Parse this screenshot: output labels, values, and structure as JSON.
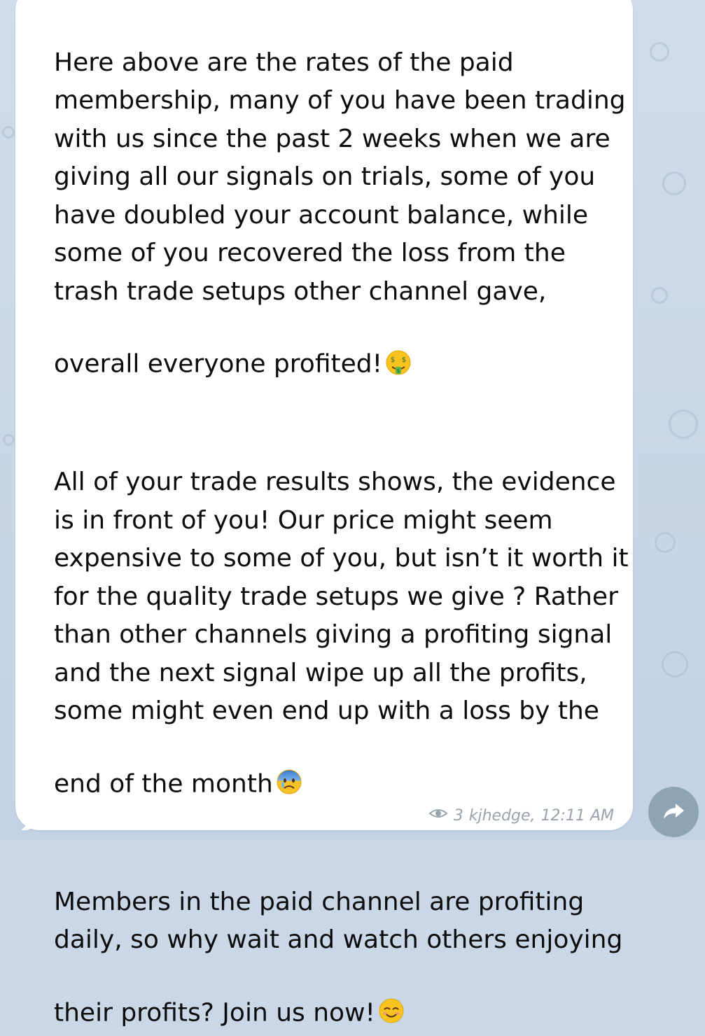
{
  "message": {
    "paragraphs": [
      "Here above are the rates of the paid membership, many of you have been trading with us since the past 2 weeks when we are giving all our signals on trials, some of you have doubled your account balance, while some of you recovered the loss from the trash trade setups other channel gave, overall everyone profited!",
      "All of your trade results shows, the evidence is in front of you! Our price might seem expensive to some of you, but isn’t it worth it for the quality trade setups we give ? Rather than other channels giving a profiting signal and the next signal wipe up all the profits, some might even end up with a loss by the end of the month",
      "Members in the paid channel are profiting daily, so why wait and watch others enjoying their profits? Join us now!"
    ],
    "emojis": [
      "money-mouth-face-icon",
      "anxious-face-with-sweat-icon",
      "smiling-face-with-smiling-eyes-icon"
    ],
    "meta": {
      "views": "3",
      "author": "kjhedge,",
      "time": "12:11 AM"
    }
  },
  "actions": {
    "forward_icon": "forward-arrow-icon"
  },
  "colors": {
    "background": "#c9d7e6",
    "bubble": "#ffffff",
    "text": "#0c0c0c",
    "meta": "#9aa3ad",
    "forward_button": "#8fa3b7"
  }
}
